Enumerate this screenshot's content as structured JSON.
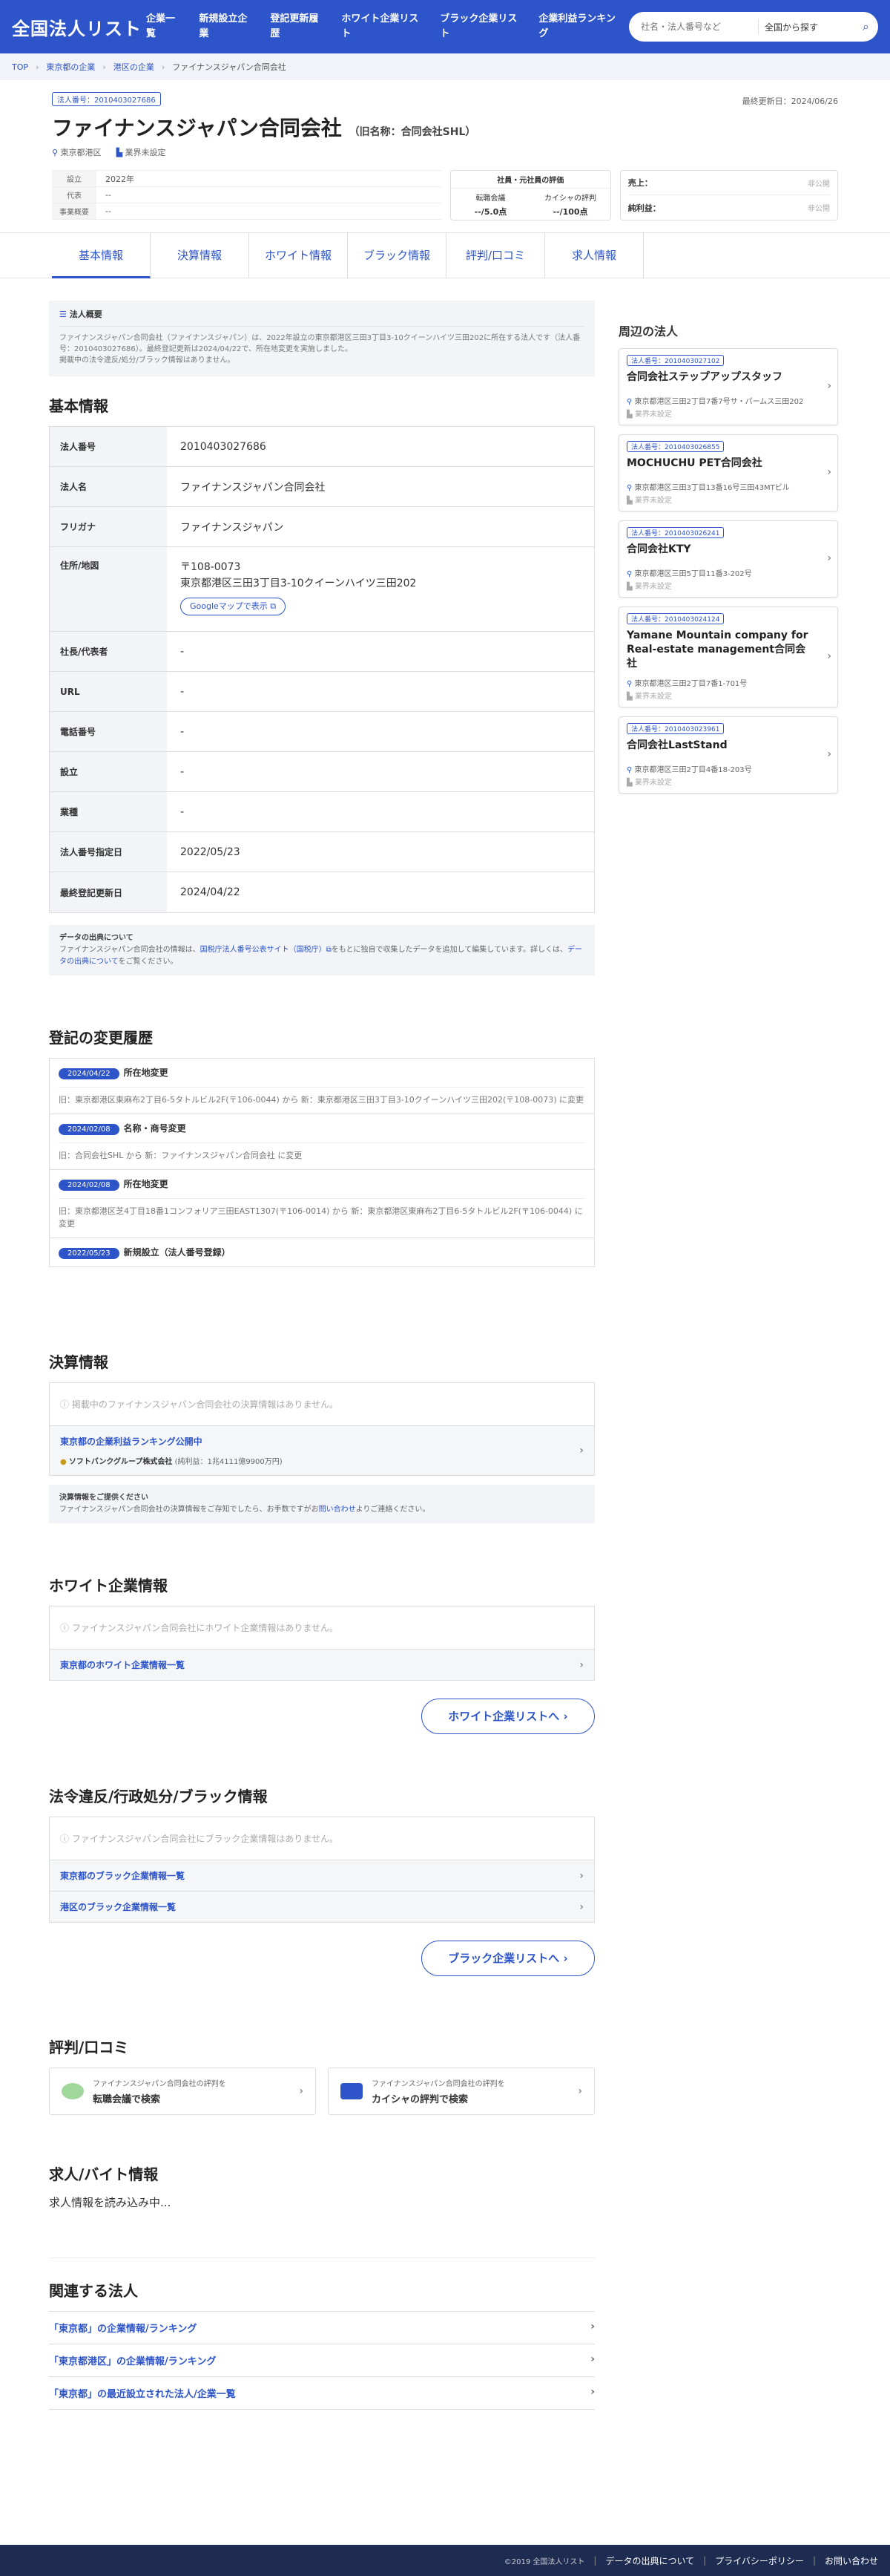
{
  "header": {
    "logo": "全国法人リスト",
    "nav": [
      {
        "label": "企業一覧"
      },
      {
        "label": "新規設立企業"
      },
      {
        "label": "登記更新履歴"
      },
      {
        "label": "ホワイト企業リスト"
      },
      {
        "label": "ブラック企業リスト"
      },
      {
        "label": "企業利益ランキング"
      }
    ],
    "search_placeholder": "社名・法人番号など",
    "search_region": "全国から探す"
  },
  "breadcrumb": [
    "TOP",
    "東京都の企業",
    "港区の企業",
    "ファイナンスジャパン合同会社"
  ],
  "corp": {
    "badge": "法人番号：2010403027686",
    "updated": "最終更新日：2024/06/26",
    "name": "ファイナンスジャパン合同会社",
    "former_name": "（旧名称：合同会社SHL）",
    "location": "東京都港区",
    "industry": "業界未設定",
    "overview": [
      {
        "k": "設立",
        "v": "2022年"
      },
      {
        "k": "代表",
        "v": "--"
      },
      {
        "k": "事業概要",
        "v": "--"
      }
    ],
    "eval": {
      "title": "社員・元社員の評価",
      "items": [
        {
          "k": "転職会議",
          "v": "--/5.0点"
        },
        {
          "k": "カイシャの評判",
          "v": "--/100点"
        }
      ]
    },
    "sales": [
      {
        "k": "売上：",
        "v": "非公開"
      },
      {
        "k": "純利益：",
        "v": "非公開"
      }
    ]
  },
  "tabs": [
    {
      "label": "基本情報"
    },
    {
      "label": "決算情報"
    },
    {
      "label": "ホワイト情報"
    },
    {
      "label": "ブラック情報"
    },
    {
      "label": "評判/口コミ"
    },
    {
      "label": "求人情報"
    }
  ],
  "intro": {
    "title": "法人概要",
    "text": "ファイナンスジャパン合同会社（ファイナンスジャパン）は、2022年設立の東京都港区三田3丁目3-10クイーンハイツ三田202に所在する法人です（法人番号：2010403027686）。最終登記更新は2024/04/22で、所在地変更を実施しました。",
    "text2": "掲載中の法令違反/処分/ブラック情報はありません。"
  },
  "basic": {
    "title": "基本情報",
    "rows": [
      {
        "k": "法人番号",
        "v": "2010403027686"
      },
      {
        "k": "法人名",
        "v": "ファイナンスジャパン合同会社"
      },
      {
        "k": "フリガナ",
        "v": "ファイナンスジャパン"
      },
      {
        "k": "社長/代表者",
        "v": "-"
      },
      {
        "k": "URL",
        "v": "-"
      },
      {
        "k": "電話番号",
        "v": "-"
      },
      {
        "k": "設立",
        "v": "-"
      },
      {
        "k": "業種",
        "v": "-"
      },
      {
        "k": "法人番号指定日",
        "v": "2022/05/23"
      },
      {
        "k": "最終登記更新日",
        "v": "2024/04/22"
      }
    ],
    "address": {
      "k": "住所/地図",
      "zip": "〒108-0073",
      "addr": "東京都港区三田3丁目3-10クイーンハイツ三田202",
      "map_btn": "Googleマップで表示 ⧉"
    },
    "source": {
      "title": "データの出典について",
      "text1": "ファイナンスジャパン合同会社の情報は、",
      "link1": "国税庁法人番号公表サイト（国税庁）⧉",
      "text2": "をもとに独自で収集したデータを追加して編集しています。詳しくは、",
      "link2": "データの出典について",
      "text3": "をご覧ください。"
    }
  },
  "history": {
    "title": "登記の変更履歴",
    "items": [
      {
        "date": "2024/04/22",
        "title": "所在地変更",
        "desc": "旧：東京都港区東麻布2丁目6-5タトルビル2F(〒106-0044) から 新：東京都港区三田3丁目3-10クイーンハイツ三田202(〒108-0073) に変更"
      },
      {
        "date": "2024/02/08",
        "title": "名称・商号変更",
        "desc": "旧：合同会社SHL から 新：ファイナンスジャパン合同会社 に変更"
      },
      {
        "date": "2024/02/08",
        "title": "所在地変更",
        "desc": "旧：東京都港区芝4丁目18番1コンフォリア三田EAST1307(〒106-0014) から 新：東京都港区東麻布2丁目6-5タトルビル2F(〒106-0044) に変更"
      },
      {
        "date": "2022/05/23",
        "title": "新規設立（法人番号登録）",
        "desc": ""
      }
    ]
  },
  "finance": {
    "title": "決算情報",
    "empty": "掲載中のファイナンスジャパン合同会社の決算情報はありません。",
    "link": "東京都の企業利益ランキング公開中",
    "sub_corp": "ソフトバンクグループ株式会社",
    "sub_val": "(純利益：1兆4111億9900万円)",
    "note_title": "決算情報をご提供ください",
    "note": "ファイナンスジャパン合同会社の決算情報をご存知でしたら、お手数ですがお",
    "note_link": "問い合わせ",
    "note_end": "よりご連絡ください。"
  },
  "white": {
    "title": "ホワイト企業情報",
    "empty": "ファイナンスジャパン合同会社にホワイト企業情報はありません。",
    "link": "東京都のホワイト企業情報一覧",
    "btn": "ホワイト企業リストへ ›"
  },
  "black": {
    "title": "法令違反/行政処分/ブラック情報",
    "empty": "ファイナンスジャパン合同会社にブラック企業情報はありません。",
    "links": [
      "東京都のブラック企業情報一覧",
      "港区のブラック企業情報一覧"
    ],
    "btn": "ブラック企業リストへ ›"
  },
  "reviews": {
    "title": "評判/口コミ",
    "cards": [
      {
        "sub": "ファイナンスジャパン合同会社の評判を",
        "main": "転職会議で検索"
      },
      {
        "sub": "ファイナンスジャパン合同会社の評判を",
        "main": "カイシャの評判で検索"
      }
    ]
  },
  "jobs": {
    "title": "求人/バイト情報",
    "loading": "求人情報を読み込み中..."
  },
  "related": {
    "title": "関連する法人",
    "items": [
      "「東京都」の企業情報/ランキング",
      "「東京都港区」の企業情報/ランキング",
      "「東京都」の最近設立された法人/企業一覧"
    ]
  },
  "nearby": {
    "title": "周辺の法人",
    "items": [
      {
        "badge": "法人番号：2010403027102",
        "name": "合同会社ステップアップスタッフ",
        "addr": "東京都港区三田2丁目7番7号サ・パームス三田202",
        "ind": "業界未設定"
      },
      {
        "badge": "法人番号：2010403026855",
        "name": "MOCHUCHU PET合同会社",
        "addr": "東京都港区三田3丁目13番16号三田43MTビル",
        "ind": "業界未設定"
      },
      {
        "badge": "法人番号：2010403026241",
        "name": "合同会社KTY",
        "addr": "東京都港区三田5丁目11番3-202号",
        "ind": "業界未設定"
      },
      {
        "badge": "法人番号：2010403024124",
        "name": "Yamane Mountain company for Real-estate management合同会社",
        "addr": "東京都港区三田2丁目7番1-701号",
        "ind": "業界未設定"
      },
      {
        "badge": "法人番号：2010403023961",
        "name": "合同会社LastStand",
        "addr": "東京都港区三田2丁目4番18-203号",
        "ind": "業界未設定"
      }
    ]
  },
  "footer": {
    "copy": "©2019 全国法人リスト",
    "links": [
      "データの出典について",
      "プライバシーポリシー",
      "お問い合わせ"
    ]
  },
  "colors": {
    "brand": "#2d54c8",
    "footer": "#1e2c52"
  }
}
